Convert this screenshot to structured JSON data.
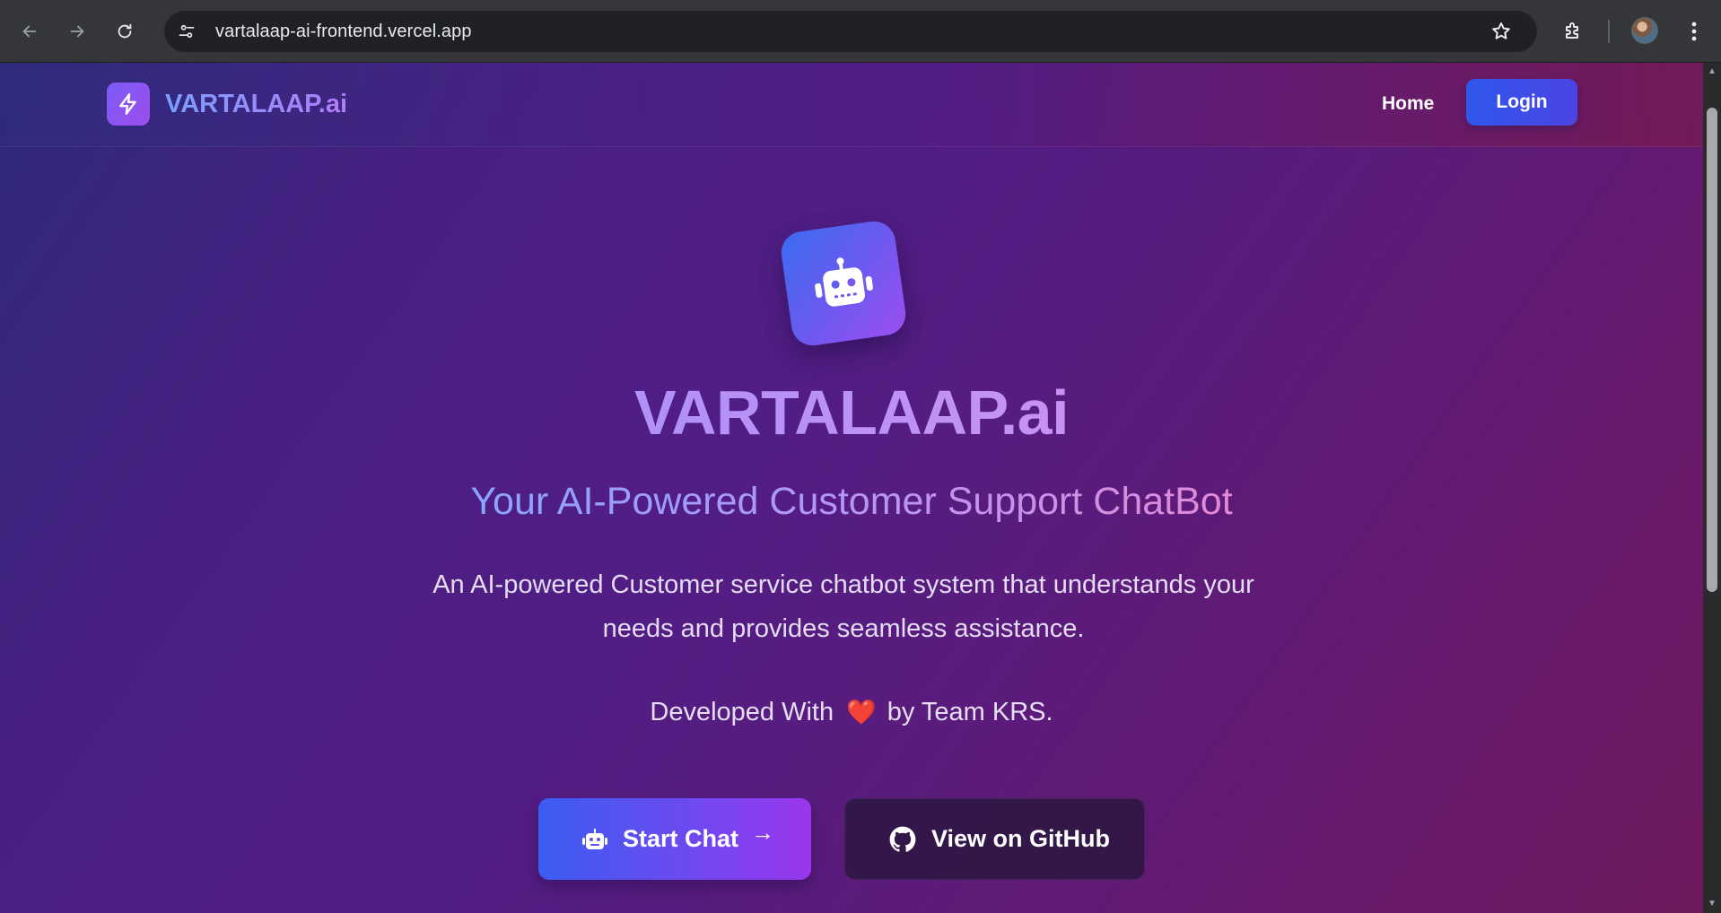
{
  "browser": {
    "url": "vartalaap-ai-frontend.vercel.app",
    "icons": {
      "back": "arrow-left-icon",
      "forward": "arrow-right-icon",
      "reload": "reload-icon",
      "site_info": "tune-icon",
      "bookmark": "star-icon",
      "extensions": "puzzle-icon",
      "profile": "avatar",
      "menu": "kebab-menu-icon"
    }
  },
  "navbar": {
    "brand": "VARTALAAP.ai",
    "brand_icon": "lightning-bolt-icon",
    "home_label": "Home",
    "login_label": "Login"
  },
  "hero": {
    "icon": "robot-icon",
    "title": "VARTALAAP.ai",
    "subtitle": "Your AI-Powered Customer Support ChatBot",
    "description": "An AI-powered Customer service chatbot system that understands your needs and provides seamless assistance.",
    "credit_prefix": "Developed With",
    "credit_emoji": "❤️",
    "credit_suffix": "by Team KRS."
  },
  "actions": {
    "start_chat_label": "Start Chat",
    "start_chat_arrow": "→",
    "github_label": "View on GitHub"
  },
  "colors": {
    "accent_blue": "#3a5df0",
    "accent_purple": "#9a36ee",
    "background_start": "#2e2a7a",
    "background_end": "#6e1a5e",
    "heart": "#e8303a"
  }
}
